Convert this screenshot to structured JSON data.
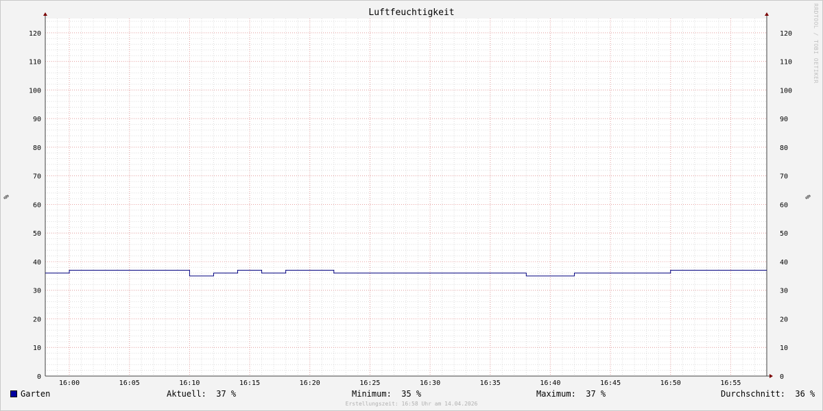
{
  "chart_data": {
    "type": "line",
    "title": "Luftfeuchtigkeit",
    "ylabel": "%",
    "y2label": "%",
    "ylim": [
      0,
      125
    ],
    "yticks": [
      0,
      10,
      20,
      30,
      40,
      50,
      60,
      70,
      80,
      90,
      100,
      110,
      120
    ],
    "xlim": [
      "15:58",
      "16:58"
    ],
    "xticks": [
      "16:00",
      "16:05",
      "16:10",
      "16:15",
      "16:20",
      "16:25",
      "16:30",
      "16:35",
      "16:40",
      "16:45",
      "16:50",
      "16:55"
    ],
    "grid": true,
    "series": [
      {
        "name": "Garten",
        "color": "#00007f",
        "steps": [
          {
            "t": "15:58",
            "v": 36
          },
          {
            "t": "16:00",
            "v": 37
          },
          {
            "t": "16:10",
            "v": 35
          },
          {
            "t": "16:12",
            "v": 36
          },
          {
            "t": "16:14",
            "v": 37
          },
          {
            "t": "16:16",
            "v": 36
          },
          {
            "t": "16:18",
            "v": 37
          },
          {
            "t": "16:22",
            "v": 36
          },
          {
            "t": "16:38",
            "v": 35
          },
          {
            "t": "16:42",
            "v": 36
          },
          {
            "t": "16:50",
            "v": 37
          },
          {
            "t": "16:58",
            "v": 37
          }
        ]
      }
    ]
  },
  "legend": {
    "series_name": "Garten",
    "swatch_color": "#0000a0",
    "current": "Aktuell:  37 %",
    "minimum": "Minimum:  35 %",
    "maximum": "Maximum:  37 %",
    "average": "Durchschnitt:  36 %"
  },
  "watermark": "RRDTOOL / TOBI OETIKER",
  "created": "Erstellungszeit: 16:58 Uhr am 14.04.2026"
}
